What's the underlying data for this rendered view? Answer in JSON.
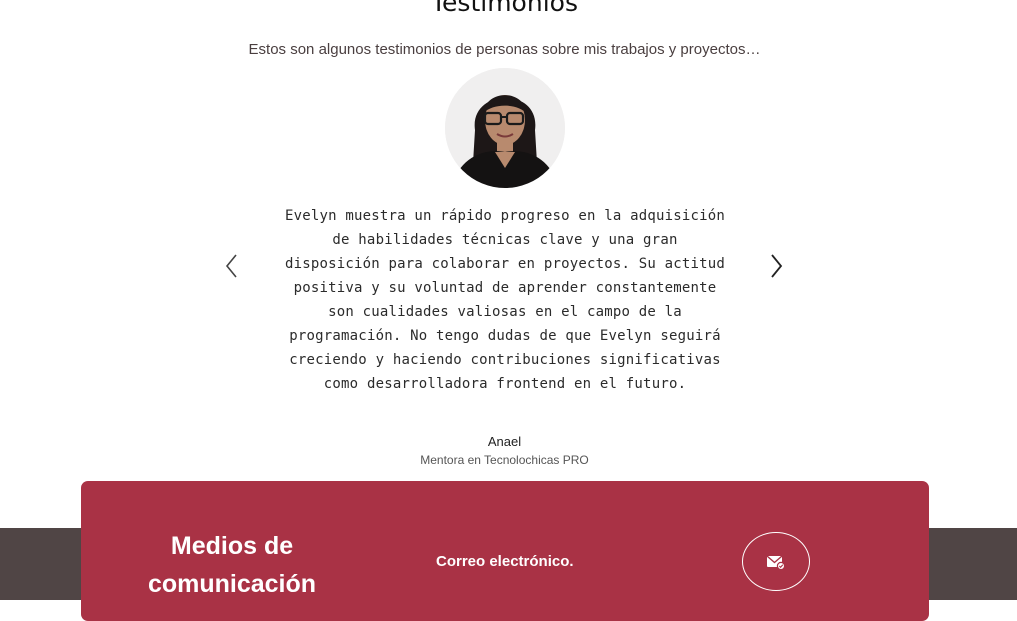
{
  "testimonials": {
    "title": "Testimonios",
    "subtitle": "Estos son algunos testimonios de personas sobre mis trabajos y proyectos…",
    "quote": "Evelyn muestra un rápido progreso en la adquisición de habilidades técnicas clave y una gran disposición para colaborar en proyectos. Su actitud positiva y su voluntad de aprender constantemente son cualidades valiosas en el campo de la programación. No tengo dudas de que Evelyn seguirá creciendo y haciendo contribuciones significativas como desarrolladora frontend en el futuro.",
    "author_name": "Anael",
    "author_role": "Mentora en Tecnolochicas PRO",
    "prev_icon": "chevron-left-icon",
    "next_icon": "chevron-right-icon"
  },
  "contact": {
    "heading": "Medios de comunicación",
    "email_label": "Correo electrónico.",
    "email_icon": "mail-icon"
  },
  "colors": {
    "card_bg": "#a93245",
    "footer_bg": "#504545",
    "subtitle_text": "#4a3f40"
  }
}
